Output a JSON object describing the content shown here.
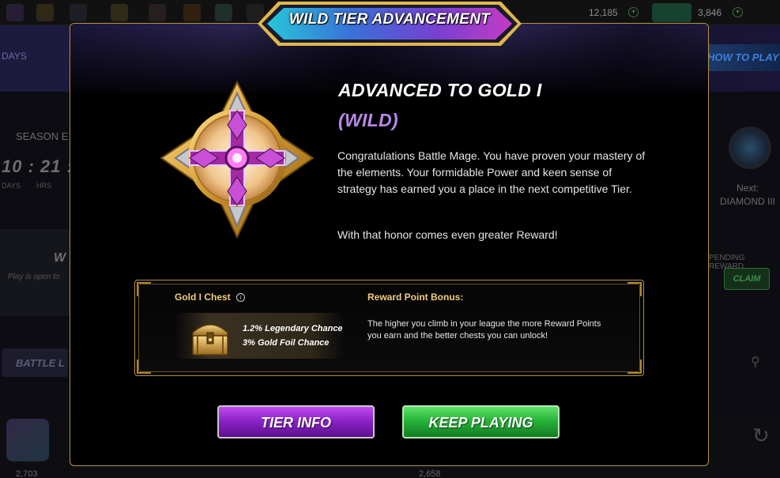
{
  "background": {
    "counters": [
      "12,185",
      "3,846"
    ],
    "top_right_banner": "HOW TO PLAY",
    "season_label": "SEASON E",
    "timer": "10 : 21 :",
    "timer_labels": [
      "DAYS",
      "HRS"
    ],
    "mode_label": "W",
    "mode_hint": "Play is open to",
    "battle_button": "BATTLE L",
    "next_label": "Next:",
    "next_tier": "DIAMOND III",
    "pending_label": "PENDING REWARD",
    "claim_label": "CLAIM",
    "bottom_numbers": [
      "2,703",
      "2,658"
    ]
  },
  "modal": {
    "title": "WILD TIER ADVANCEMENT",
    "heading": "ADVANCED TO GOLD I",
    "subheading": "(WILD)",
    "body": "Congratulations Battle Mage. You have proven your mastery of the elements. Your formidable Power and keen sense of strategy has earned you a place in the next competitive Tier.",
    "body2": "With that honor comes even greater Reward!",
    "chest": {
      "title": "Gold I Chest",
      "legendary_chance": "1.2% Legendary Chance",
      "gold_foil_chance": "3% Gold Foil Chance"
    },
    "reward_point": {
      "title": "Reward Point Bonus:",
      "text": "The higher you climb in your league the more Reward Points you earn and the better chests you can unlock!"
    },
    "buttons": {
      "tier_info": "TIER INFO",
      "keep_playing": "KEEP PLAYING"
    }
  },
  "colors": {
    "accent_gold": "#b39443",
    "wild_purple": "#b889e6",
    "tier_button": "#8b24c9",
    "keep_button": "#27b53a"
  }
}
